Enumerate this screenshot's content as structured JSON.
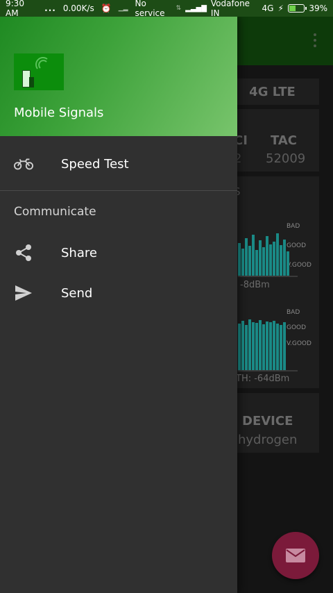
{
  "status_bar": {
    "time": "9:30 AM",
    "dots": "...",
    "speed": "0.00K/s",
    "no_service": "No service",
    "carrier": "Vodafone IN",
    "network": "4G",
    "battery": "39%",
    "battery_level": 0.39
  },
  "background_app": {
    "network_type": "4G LTE",
    "ci_head": "CI",
    "ci_value": "2",
    "tac_head": "TAC",
    "tac_value": "52009",
    "graphs_title": "S",
    "graph1": {
      "bad": "BAD",
      "good": "GOOD",
      "vgood": "V.GOOD",
      "reading": "-8dBm"
    },
    "graph2": {
      "bad": "BAD",
      "good": "GOOD",
      "vgood": "V.GOOD",
      "reading": "TH: -64dBm"
    },
    "device_head": "DEVICE",
    "device_value": "hydrogen"
  },
  "drawer": {
    "app_name": "Mobile Signals",
    "items": [
      {
        "label": "Speed Test",
        "icon": "motorcycle-icon"
      }
    ],
    "section": "Communicate",
    "communicate_items": [
      {
        "label": "Share",
        "icon": "share-icon"
      },
      {
        "label": "Send",
        "icon": "send-icon"
      }
    ]
  },
  "colors": {
    "accent": "#2e9a2e",
    "drawer_bg": "#303030",
    "fab": "#7b1a3a",
    "bar": "#1a8a86"
  }
}
